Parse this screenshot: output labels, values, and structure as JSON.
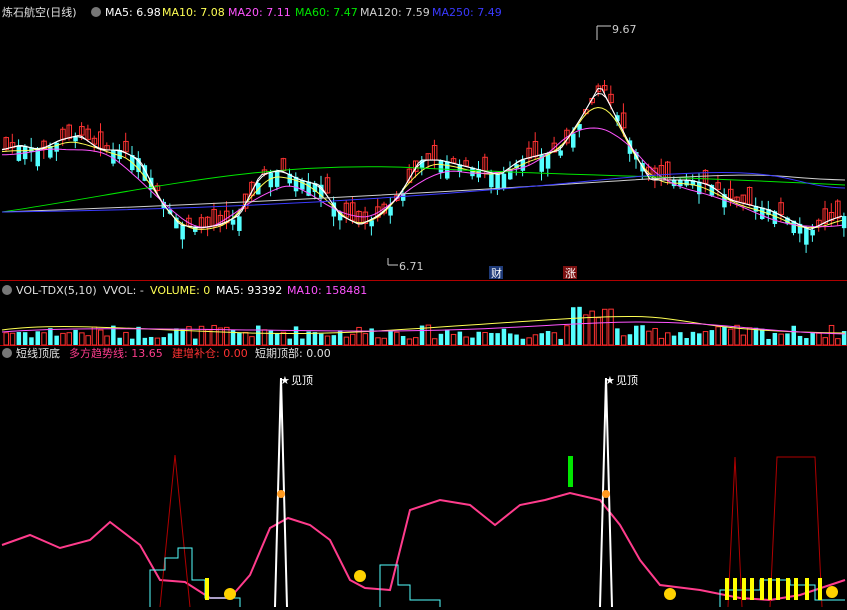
{
  "title": "炼石航空(日线)",
  "header": {
    "ma5": "MA5: 6.98",
    "ma10": "MA10: 7.08",
    "ma20": "MA20: 7.11",
    "ma60": "MA60: 7.47",
    "ma120": "MA120: 7.59",
    "ma250": "MA250: 7.49"
  },
  "price_annotations": {
    "high": "9.67",
    "low": "6.71",
    "tag_cai": "财",
    "tag_zhang": "涨"
  },
  "vol_header": {
    "name": "VOL-TDX(5,10)",
    "vvol": "VVOL: -",
    "volume": "VOLUME: 0",
    "ma5": "MA5: 93392",
    "ma10": "MA10: 158481"
  },
  "ind_header": {
    "name": "短线顶底",
    "trend": "多方趋势线: 13.65",
    "buildup": "建增补仓: 0.00",
    "top": "短期顶部: 0.00"
  },
  "ind_annotations": {
    "top_label_1": "见顶",
    "top_label_2": "见顶"
  },
  "colors": {
    "up": "#ff3232",
    "down": "#54ffff",
    "ma5": "#ffffff",
    "ma10": "#ffff54",
    "ma20": "#ff54ff",
    "ma60": "#00e600",
    "ma120": "#d0d0d0",
    "ma250": "#3a3aff",
    "trend": "#ff3c8c",
    "pane_border": "#b00000"
  },
  "chart_data": [
    {
      "type": "candlestick",
      "title": "炼石航空(日线)",
      "ylim": [
        6.6,
        9.8
      ],
      "annotations": [
        {
          "text": "9.67",
          "kind": "high"
        },
        {
          "text": "6.71",
          "kind": "low"
        }
      ],
      "series": [
        {
          "name": "MA5",
          "last": 6.98
        },
        {
          "name": "MA10",
          "last": 7.08
        },
        {
          "name": "MA20",
          "last": 7.11
        },
        {
          "name": "MA60",
          "last": 7.47
        },
        {
          "name": "MA120",
          "last": 7.59
        },
        {
          "name": "MA250",
          "last": 7.49
        }
      ]
    },
    {
      "type": "bar",
      "title": "VOL-TDX(5,10)",
      "series": [
        {
          "name": "VOLUME",
          "last": 0
        },
        {
          "name": "MA5",
          "last": 93392
        },
        {
          "name": "MA10",
          "last": 158481
        }
      ]
    },
    {
      "type": "line",
      "title": "短线顶底",
      "series": [
        {
          "name": "多方趋势线",
          "last": 13.65
        },
        {
          "name": "建增补仓",
          "last": 0.0
        },
        {
          "name": "短期顶部",
          "last": 0.0
        }
      ]
    }
  ]
}
